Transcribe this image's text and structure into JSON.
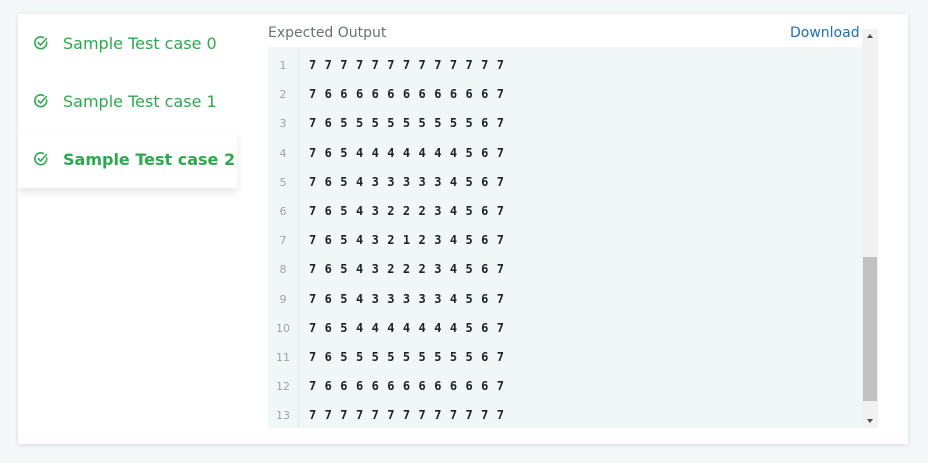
{
  "sidebar": {
    "items": [
      {
        "label": "Sample Test case 0",
        "status": "passed",
        "active": false
      },
      {
        "label": "Sample Test case 1",
        "status": "passed",
        "active": false
      },
      {
        "label": "Sample Test case 2",
        "status": "passed",
        "active": true
      }
    ],
    "icon": "check-circle-icon"
  },
  "output": {
    "title": "Expected Output",
    "download_label": "Download",
    "lines": [
      {
        "n": "1",
        "text": "7 7 7 7 7 7 7 7 7 7 7 7 7"
      },
      {
        "n": "2",
        "text": "7 6 6 6 6 6 6 6 6 6 6 6 7"
      },
      {
        "n": "3",
        "text": "7 6 5 5 5 5 5 5 5 5 5 6 7"
      },
      {
        "n": "4",
        "text": "7 6 5 4 4 4 4 4 4 4 5 6 7"
      },
      {
        "n": "5",
        "text": "7 6 5 4 3 3 3 3 3 4 5 6 7"
      },
      {
        "n": "6",
        "text": "7 6 5 4 3 2 2 2 3 4 5 6 7"
      },
      {
        "n": "7",
        "text": "7 6 5 4 3 2 1 2 3 4 5 6 7"
      },
      {
        "n": "8",
        "text": "7 6 5 4 3 2 2 2 3 4 5 6 7"
      },
      {
        "n": "9",
        "text": "7 6 5 4 3 3 3 3 3 4 5 6 7"
      },
      {
        "n": "10",
        "text": "7 6 5 4 4 4 4 4 4 4 5 6 7"
      },
      {
        "n": "11",
        "text": "7 6 5 5 5 5 5 5 5 5 5 6 7"
      },
      {
        "n": "12",
        "text": "7 6 6 6 6 6 6 6 6 6 6 6 7"
      },
      {
        "n": "13",
        "text": "7 7 7 7 7 7 7 7 7 7 7 7 7"
      }
    ]
  },
  "colors": {
    "accent_green": "#2ea84f",
    "link_blue": "#1f6fb3",
    "code_bg": "#f1f6f7"
  }
}
